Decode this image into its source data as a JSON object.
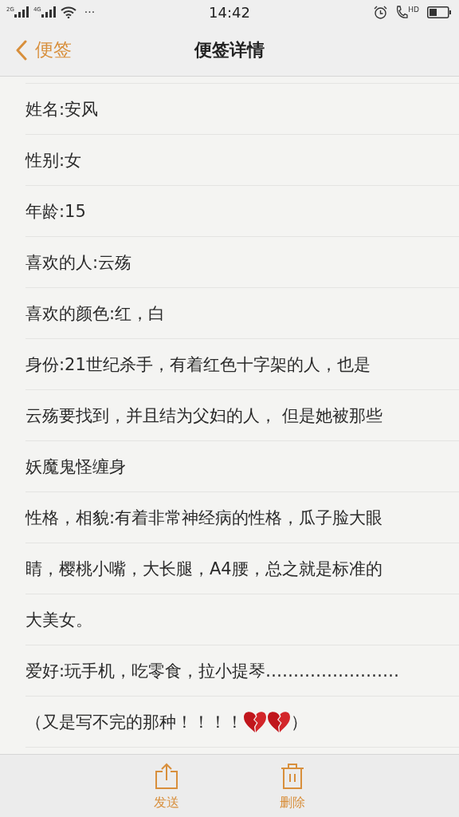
{
  "status_bar": {
    "sim_1": "2G",
    "sim_2": "4G",
    "more": "···",
    "time": "14:42",
    "call_label": "HD"
  },
  "nav_bar": {
    "back_label": "便签",
    "title": "便签详情"
  },
  "note_lines": [
    {
      "kind": "text",
      "text": "姓名:安风"
    },
    {
      "kind": "text",
      "text": "性别:女"
    },
    {
      "kind": "text",
      "text": "年龄:15"
    },
    {
      "kind": "text",
      "text": "喜欢的人:云殇"
    },
    {
      "kind": "text",
      "text": "喜欢的颜色:红，白"
    },
    {
      "kind": "text",
      "text": "身份:21世纪杀手，有着红色十字架的人，也是"
    },
    {
      "kind": "text",
      "text": "云殇要找到，并且结为父妇的人， 但是她被那些"
    },
    {
      "kind": "text",
      "text": "妖魔鬼怪缠身"
    },
    {
      "kind": "text",
      "text": "性格，相貌:有着非常神经病的性格，瓜子脸大眼"
    },
    {
      "kind": "text",
      "text": "睛，樱桃小嘴，大长腿，A4腰，总之就是标准的"
    },
    {
      "kind": "text",
      "text": "大美女。"
    },
    {
      "kind": "text",
      "text": "爱好:玩手机，吃零食，拉小提琴……………………"
    },
    {
      "kind": "emoji",
      "text": "（又是写不完的那种！！！！",
      "after": "）"
    }
  ],
  "toolbar": [
    {
      "kind": "share",
      "label": "发送"
    },
    {
      "kind": "delete",
      "label": "删除"
    }
  ]
}
